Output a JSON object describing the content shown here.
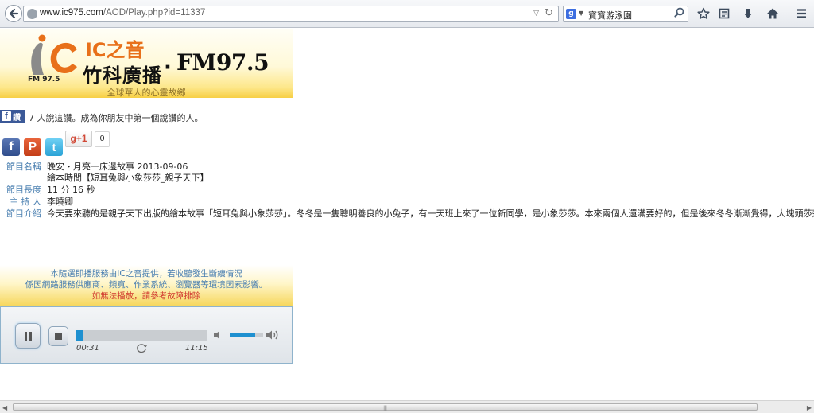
{
  "browser": {
    "url_host": "www.ic975.com",
    "url_path": "/AOD/Play.php?id=11337",
    "search_value": "寶寶游泳園",
    "search_engine_letter": "g"
  },
  "banner": {
    "ic_text": "IC之音",
    "fm_small": "FM 97.5",
    "station": "竹科廣播",
    "dot": "·",
    "fm_big": "FM97.5",
    "slogan": "全球華人的心靈故鄉"
  },
  "social": {
    "fb_like_label": "讚",
    "like_text": "7 人說這讚。成為你朋友中第一個說讚的人。",
    "gplus_label": "g+1",
    "gplus_count": "0"
  },
  "program": {
    "rows": [
      {
        "label": "節目名稱",
        "value": "晚安・月亮一床邊故事 2013-09-06"
      },
      {
        "label": "",
        "value": "繪本時間【短耳兔與小象莎莎_親子天下】"
      },
      {
        "label": "節目長度",
        "value": "11 分 16 秒"
      },
      {
        "label": "主 持 人",
        "value": "李曉卿"
      },
      {
        "label": "節目介紹",
        "value": "今天要來聽的是親子天下出版的繪本故事「短耳兔與小象莎莎」。冬冬是一隻聰明善良的小兔子，有一天班上來了一位新同學，是小象莎莎。本來兩個人還滿要好的，但是後來冬冬漸漸覺得，大塊頭莎莎老是跟前跟"
      }
    ]
  },
  "notice": {
    "line1": "本隨選即播服務由IC之音提供，若收聽發生斷續情況",
    "line2": "係因網路服務供應商、頻寬、作業系統、瀏覽器等環境因素影響。",
    "line3": "如無法播放，請參考故障排除"
  },
  "player": {
    "current_time": "00:31",
    "total_time": "11:15",
    "progress": 0.046,
    "volume": 0.75
  },
  "colors": {
    "accent_blue": "#1e90d0",
    "label_blue": "#4a7fb0",
    "notice_red": "#d0382e",
    "logo_orange": "#e8701a"
  }
}
